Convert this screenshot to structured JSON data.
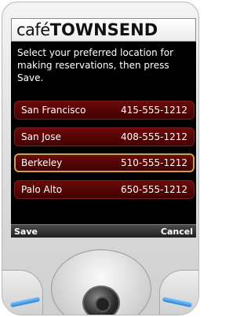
{
  "app": {
    "logo_prefix": "café",
    "logo_name": "TOWNSEND"
  },
  "screen": {
    "instructions": "Select your preferred location for making reservations, then press Save.",
    "locations": [
      {
        "city": "San Francisco",
        "phone": "415-555-1212",
        "selected": false
      },
      {
        "city": "San Jose",
        "phone": "408-555-1212",
        "selected": false
      },
      {
        "city": "Berkeley",
        "phone": "510-555-1212",
        "selected": true
      },
      {
        "city": "Palo Alto",
        "phone": "650-555-1212",
        "selected": false
      }
    ]
  },
  "softkeys": {
    "left": "Save",
    "right": "Cancel"
  },
  "colors": {
    "item_background": "#5a0505",
    "selected_border": "#c7a34a",
    "screen_background": "#000000",
    "side_key_accent": "#2a86d8"
  }
}
